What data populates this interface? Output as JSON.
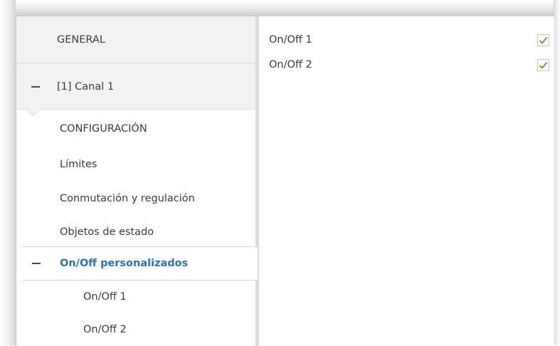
{
  "sidebar": {
    "general": "GENERAL",
    "canal": "[1] Canal 1",
    "configuracion": "CONFIGURACIÓN",
    "limites": "Límites",
    "conmutacion": "Conmutación y regulación",
    "objetos": "Objetos de estado",
    "onoff_personalizados": "On/Off personalizados",
    "sub_onoff1": "On/Off 1",
    "sub_onoff2": "On/Off 2"
  },
  "main": {
    "rows": [
      {
        "label": "On/Off 1",
        "checked": true
      },
      {
        "label": "On/Off 2",
        "checked": true
      }
    ]
  },
  "colors": {
    "selected_text": "#2a73b7",
    "check_green": "#5fa832"
  }
}
